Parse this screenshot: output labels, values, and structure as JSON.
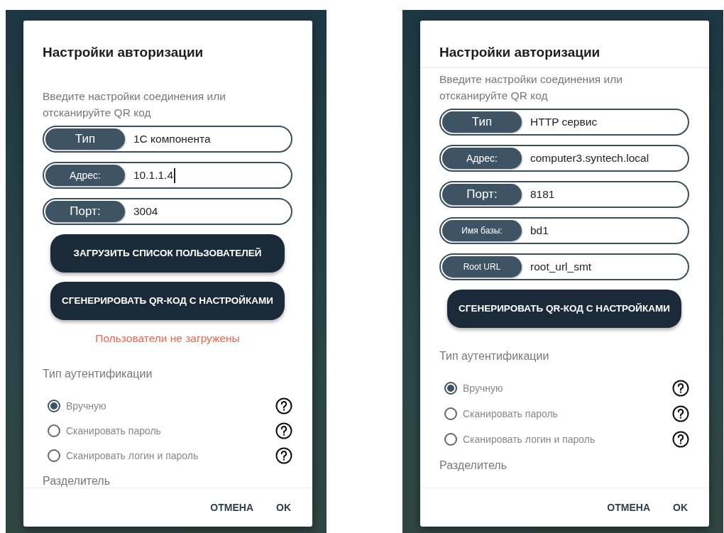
{
  "screens": [
    {
      "dialog": {
        "title": "Настройки авторизации",
        "title_divider": false,
        "subtitle": "Введите настройки соединения или отсканируйте QR код",
        "fields": [
          {
            "label": "Тип",
            "kind": "large",
            "value": "1С компонента",
            "focused": false
          },
          {
            "label": "Адрес:",
            "kind": "medium",
            "value": "10.1.1.4",
            "focused": true
          },
          {
            "label": "Порт:",
            "kind": "large",
            "value": "3004",
            "focused": false
          }
        ],
        "buttons": [
          "ЗАГРУЗИТЬ СПИСОК ПОЛЬЗОВАТЕЛЕЙ",
          "СГЕНЕРИРОВАТЬ QR-КОД С НАСТРОЙКАМИ"
        ],
        "status": "Пользователи не загружены",
        "auth_label": "Тип аутентификации",
        "auth_options": [
          {
            "label": "Вручную",
            "selected": true
          },
          {
            "label": "Сканировать пароль",
            "selected": false
          },
          {
            "label": "Сканировать логин и пароль",
            "selected": false
          }
        ],
        "separator_label": "Разделитель",
        "actions": [
          "ОТМЕНА",
          "OK"
        ]
      }
    },
    {
      "dialog": {
        "title": "Настройки авторизации",
        "title_divider": true,
        "subtitle": "Введите настройки соединения или отсканируйте QR код",
        "fields": [
          {
            "label": "Тип",
            "kind": "large",
            "value": "HTTP сервис",
            "focused": false
          },
          {
            "label": "Адрес:",
            "kind": "medium",
            "value": "computer3.syntech.local",
            "focused": false
          },
          {
            "label": "Порт:",
            "kind": "large",
            "value": "8181",
            "focused": false
          },
          {
            "label": "Имя базы:",
            "kind": "small",
            "value": "bd1",
            "focused": false
          },
          {
            "label": "Root URL",
            "kind": "small",
            "value": "root_url_smt",
            "focused": false
          }
        ],
        "buttons": [
          "СГЕНЕРИРОВАТЬ QR-КОД С НАСТРОЙКАМИ"
        ],
        "auth_label": "Тип аутентификации",
        "auth_options": [
          {
            "label": "Вручную",
            "selected": true
          },
          {
            "label": "Сканировать пароль",
            "selected": false
          },
          {
            "label": "Сканировать логин и пароль",
            "selected": false
          }
        ],
        "separator_label": "Разделитель",
        "actions": [
          "ОТМЕНА",
          "OK"
        ]
      }
    }
  ]
}
